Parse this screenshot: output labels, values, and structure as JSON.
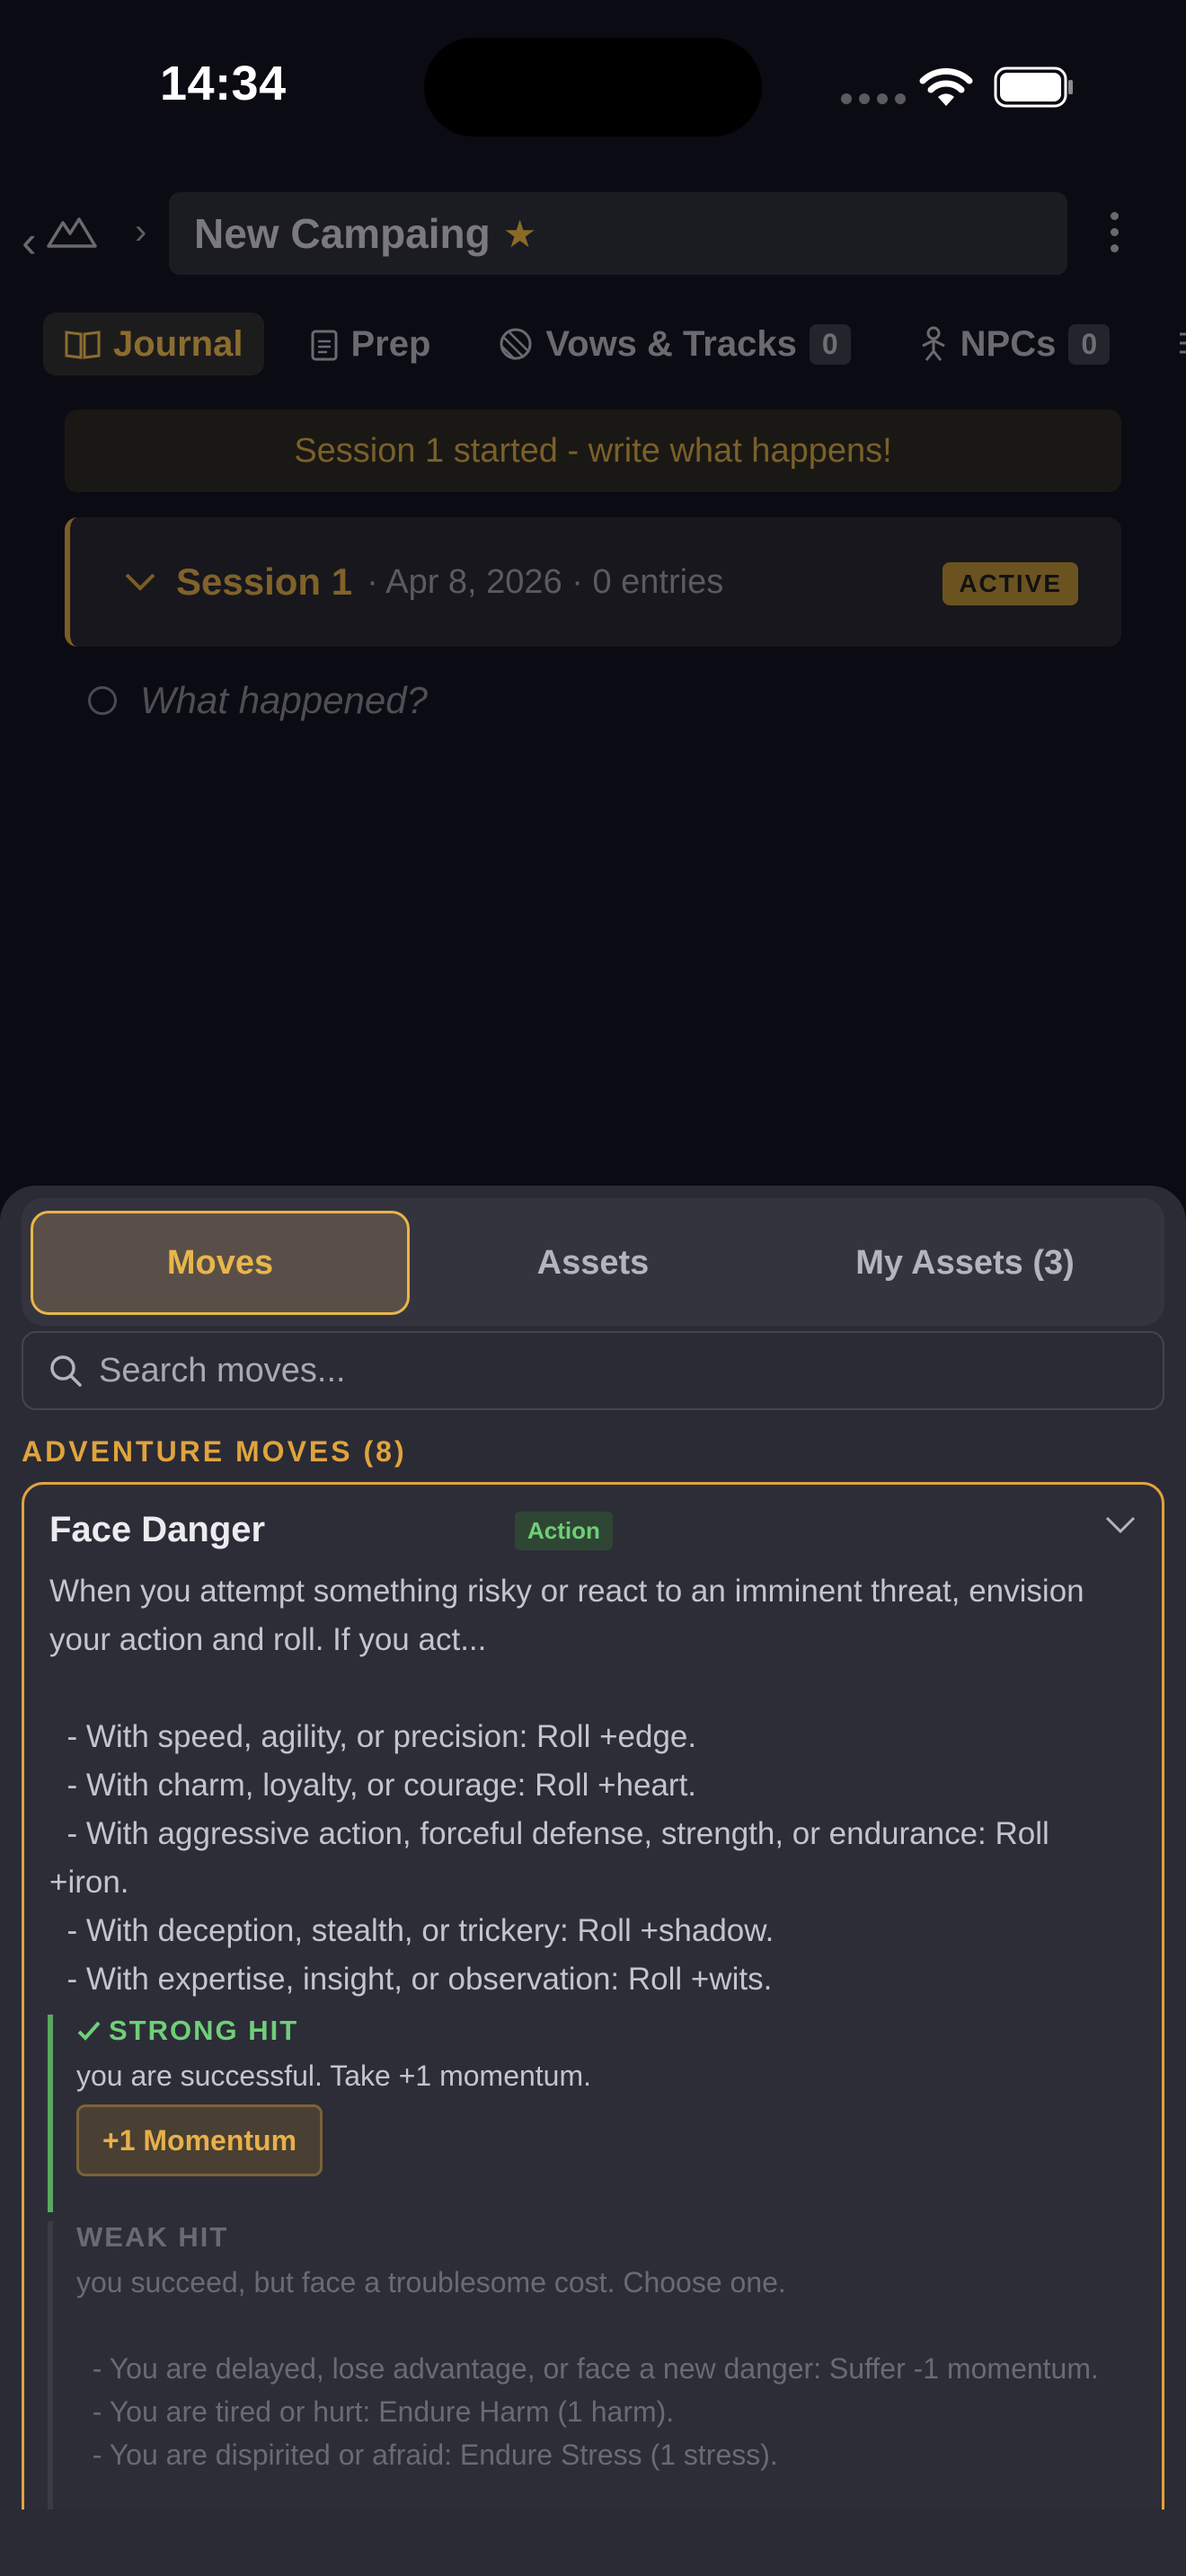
{
  "status": {
    "time": "14:34"
  },
  "nav": {
    "campaign_title": "New Campaing",
    "tabs": [
      {
        "label": "Journal"
      },
      {
        "label": "Prep"
      },
      {
        "label": "Vows & Tracks",
        "count": "0"
      },
      {
        "label": "NPCs",
        "count": "0"
      }
    ]
  },
  "journal": {
    "banner": "Session 1 started - write what happens!",
    "session": {
      "name": "Session 1",
      "meta": "· Apr 8, 2026 · 0 entries",
      "badge": "ACTIVE"
    },
    "entry_placeholder": "What happened?"
  },
  "sheet": {
    "segments": [
      "Moves",
      "Assets",
      "My Assets (3)"
    ],
    "search_placeholder": "Search moves...",
    "section_title": "ADVENTURE MOVES (8)",
    "move": {
      "title": "Face Danger",
      "tag": "Action",
      "description": "When you attempt something risky or react to an imminent threat, envision your action and roll. If you act...\n\n  - With speed, agility, or precision: Roll +edge.\n  - With charm, loyalty, or courage: Roll +heart.\n  - With aggressive action, forceful defense, strength, or endurance: Roll +iron.\n  - With deception, stealth, or trickery: Roll +shadow.\n  - With expertise, insight, or observation: Roll +wits.",
      "strong_hit": {
        "label": "STRONG HIT",
        "text": "you are successful. Take +1 momentum.",
        "button": "+1 Momentum"
      },
      "weak_hit": {
        "label": "WEAK HIT",
        "text": "you succeed, but face a troublesome cost. Choose one.\n\n  - You are delayed, lose advantage, or face a new danger: Suffer -1 momentum.\n  - You are tired or hurt: Endure Harm (1 harm).\n  - You are dispirited or afraid: Endure Stress (1 stress)."
      }
    }
  },
  "colors": {
    "accent": "#e0a43c",
    "success": "#6fcf78",
    "sheet_bg": "#2b2b36"
  }
}
